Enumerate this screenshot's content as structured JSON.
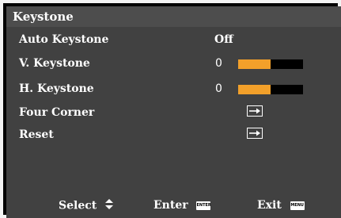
{
  "title": "Keystone",
  "menu": {
    "auto_keystone": {
      "label": "Auto Keystone",
      "value": "Off"
    },
    "v_keystone": {
      "label": "V. Keystone",
      "value": "0",
      "level": 0.5
    },
    "h_keystone": {
      "label": "H. Keystone",
      "value": "0",
      "level": 0.5
    },
    "four_corner": {
      "label": "Four Corner",
      "icon": "enter-arrow-icon"
    },
    "reset": {
      "label": "Reset",
      "icon": "enter-arrow-icon"
    }
  },
  "footer": {
    "select_label": "Select",
    "select_icon": "up-down-arrows-icon",
    "enter_label": "Enter",
    "enter_button": "ENTER",
    "exit_label": "Exit",
    "exit_button": "MENU"
  },
  "colors": {
    "accent": "#f2a02a",
    "menu_bg": "#414141",
    "title_bg": "#4d4d4d",
    "border": "#f3f3f3"
  }
}
